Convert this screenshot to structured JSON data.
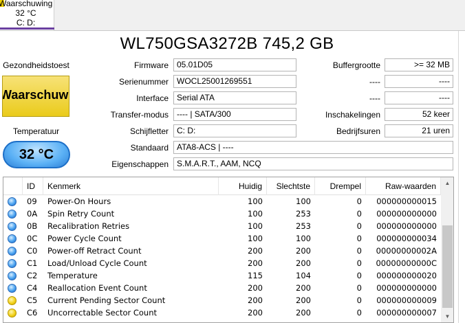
{
  "disk_tab": {
    "status": "Waarschuwing",
    "temperature": "32 °C",
    "drives": "C: D:"
  },
  "title": "WL750GSA3272B 745,2 GB",
  "left": {
    "health_label": "Gezondheidstoest",
    "health_value": "Waarschuwing",
    "temperature_label": "Temperatuur",
    "temperature_value": "32 °C"
  },
  "info": {
    "firmware_label": "Firmware",
    "firmware": "05.01D05",
    "serial_label": "Serienummer",
    "serial": "WOCL25001269551",
    "interface_label": "Interface",
    "interface": "Serial ATA",
    "transfer_label": "Transfer-modus",
    "transfer": "---- | SATA/300",
    "drive_letter_label": "Schijfletter",
    "drive_letter": "C: D:",
    "standard_label": "Standaard",
    "standard": "ATA8-ACS | ----",
    "features_label": "Eigenschappen",
    "features": "S.M.A.R.T., AAM, NCQ",
    "buffer_label": "Buffergrootte",
    "buffer": ">= 32 MB",
    "blank1_label": "----",
    "blank1": "----",
    "blank2_label": "----",
    "blank2": "----",
    "power_on_count_label": "Inschakelingen",
    "power_on_count": "52 keer",
    "power_on_hours_label": "Bedrijfsuren",
    "power_on_hours": "21 uren"
  },
  "smart": {
    "headers": {
      "id": "ID",
      "attribute": "Kenmerk",
      "current": "Huidig",
      "worst": "Slechtste",
      "threshold": "Drempel",
      "raw": "Raw-waarden"
    },
    "rows": [
      {
        "status": "blue",
        "id": "09",
        "name": "Power-On Hours",
        "current": "100",
        "worst": "100",
        "threshold": "0",
        "raw": "000000000015"
      },
      {
        "status": "blue",
        "id": "0A",
        "name": "Spin Retry Count",
        "current": "100",
        "worst": "253",
        "threshold": "0",
        "raw": "000000000000"
      },
      {
        "status": "blue",
        "id": "0B",
        "name": "Recalibration Retries",
        "current": "100",
        "worst": "253",
        "threshold": "0",
        "raw": "000000000000"
      },
      {
        "status": "blue",
        "id": "0C",
        "name": "Power Cycle Count",
        "current": "100",
        "worst": "100",
        "threshold": "0",
        "raw": "000000000034"
      },
      {
        "status": "blue",
        "id": "C0",
        "name": "Power-off Retract Count",
        "current": "200",
        "worst": "200",
        "threshold": "0",
        "raw": "00000000002A"
      },
      {
        "status": "blue",
        "id": "C1",
        "name": "Load/Unload Cycle Count",
        "current": "200",
        "worst": "200",
        "threshold": "0",
        "raw": "00000000000C"
      },
      {
        "status": "blue",
        "id": "C2",
        "name": "Temperature",
        "current": "115",
        "worst": "104",
        "threshold": "0",
        "raw": "000000000020"
      },
      {
        "status": "blue",
        "id": "C4",
        "name": "Reallocation Event Count",
        "current": "200",
        "worst": "200",
        "threshold": "0",
        "raw": "000000000000"
      },
      {
        "status": "yellow",
        "id": "C5",
        "name": "Current Pending Sector Count",
        "current": "200",
        "worst": "200",
        "threshold": "0",
        "raw": "000000000009"
      },
      {
        "status": "yellow",
        "id": "C6",
        "name": "Uncorrectable Sector Count",
        "current": "200",
        "worst": "200",
        "threshold": "0",
        "raw": "000000000007"
      }
    ]
  },
  "scrollbar": {
    "up_icon": "▲",
    "down_icon": "▼"
  },
  "colors": {
    "warning_yellow": "#eacb1b",
    "temperature_blue": "#5ab0f5",
    "tab_underline": "#6a3fa0"
  }
}
